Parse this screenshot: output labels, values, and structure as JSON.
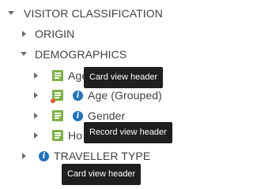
{
  "tree": {
    "root": {
      "label": "VISITOR CLASSIFICATION",
      "expanded": true
    },
    "origin": {
      "label": "ORIGIN",
      "expanded": false
    },
    "demographics": {
      "label": "DEMOGRAPHICS",
      "expanded": true
    },
    "age": {
      "label": "Age",
      "icon": "card-icon"
    },
    "age_grouped": {
      "label": "Age (Grouped)",
      "icon": "info-icon"
    },
    "gender": {
      "label": "Gender",
      "icon": "info-icon"
    },
    "ho": {
      "label": "Ho",
      "icon": "card-icon"
    },
    "traveller_type": {
      "label": "TRAVELLER TYPE",
      "expanded": false,
      "icon": "info-icon"
    }
  },
  "tooltips": {
    "card_view_header_1": "Card view header",
    "record_view_header": "Record view header",
    "card_view_header_2": "Card view header"
  },
  "icons": {
    "info_glyph": "i"
  },
  "colors": {
    "card_icon": "#7cb342",
    "info_icon": "#1e73be",
    "warning_dot": "#e8572a",
    "tooltip_bg": "#1f1f1f"
  }
}
